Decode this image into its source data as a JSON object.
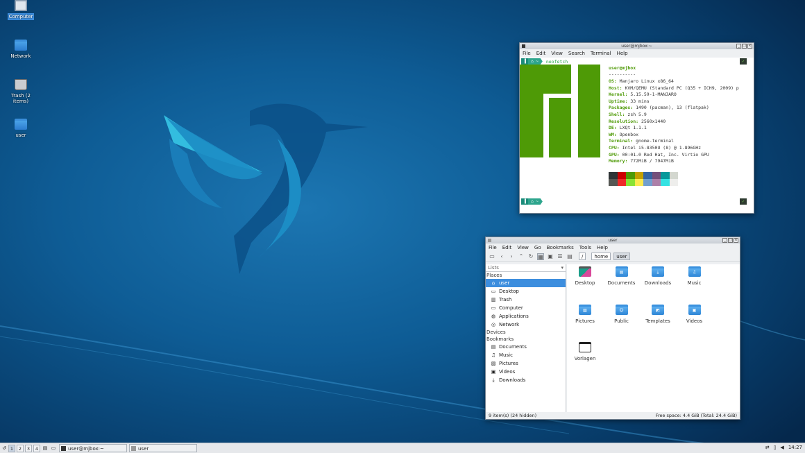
{
  "desktop": {
    "icons": [
      {
        "label": "Computer",
        "icon": "computer-icon",
        "selected": true
      },
      {
        "label": "Network",
        "icon": "network-icon"
      },
      {
        "label": "Trash (2 items)",
        "icon": "trash-icon"
      },
      {
        "label": "user",
        "icon": "home-folder-icon"
      }
    ]
  },
  "terminal": {
    "title": "user@mjbox:~",
    "menu": [
      "File",
      "Edit",
      "View",
      "Search",
      "Terminal",
      "Help"
    ],
    "prompt_symbol": "~",
    "command": "neofetch",
    "header": "user@mjbox",
    "separator": "----------",
    "info": [
      {
        "key": "OS",
        "value": "Manjaro Linux x86_64"
      },
      {
        "key": "Host",
        "value": "KVM/QEMU (Standard PC (Q35 + ICH9, 2009) p"
      },
      {
        "key": "Kernel",
        "value": "5.15.59-1-MANJARO"
      },
      {
        "key": "Uptime",
        "value": "33 mins"
      },
      {
        "key": "Packages",
        "value": "1490 (pacman), 13 (flatpak)"
      },
      {
        "key": "Shell",
        "value": "zsh 5.9"
      },
      {
        "key": "Resolution",
        "value": "2560x1440"
      },
      {
        "key": "DE",
        "value": "LXQt 1.1.1"
      },
      {
        "key": "WM",
        "value": "Openbox"
      },
      {
        "key": "Terminal",
        "value": "gnome-terminal"
      },
      {
        "key": "CPU",
        "value": "Intel i5-8350U (8) @ 1.896GHz"
      },
      {
        "key": "GPU",
        "value": "00:01.0 Red Hat, Inc. Virtio GPU"
      },
      {
        "key": "Memory",
        "value": "772MiB / 7947MiB"
      }
    ],
    "palette_top": [
      "#2e3436",
      "#cc0000",
      "#4e9a06",
      "#c4a000",
      "#3465a4",
      "#75507b",
      "#06989a",
      "#d3d7cf"
    ],
    "palette_bottom": [
      "#555753",
      "#ef2929",
      "#8ae234",
      "#fce94f",
      "#729fcf",
      "#ad7fa8",
      "#34e2e2",
      "#eeeeec"
    ],
    "logo_color": "#4e9a06",
    "check": "✓"
  },
  "filemanager": {
    "title": "user",
    "menu": [
      "File",
      "Edit",
      "View",
      "Go",
      "Bookmarks",
      "Tools",
      "Help"
    ],
    "path": [
      "/",
      "home",
      "user"
    ],
    "side_header": "Lists",
    "places_label": "Places",
    "places": [
      {
        "label": "user",
        "icon": "home-icon",
        "selected": true
      },
      {
        "label": "Desktop",
        "icon": "desktop-icon"
      },
      {
        "label": "Trash",
        "icon": "trash-icon"
      },
      {
        "label": "Computer",
        "icon": "computer-icon"
      },
      {
        "label": "Applications",
        "icon": "applications-icon"
      },
      {
        "label": "Network",
        "icon": "network-icon"
      }
    ],
    "devices_label": "Devices",
    "bookmarks_label": "Bookmarks",
    "bookmarks": [
      {
        "label": "Documents",
        "icon": "documents-icon"
      },
      {
        "label": "Music",
        "icon": "music-icon"
      },
      {
        "label": "Pictures",
        "icon": "pictures-icon"
      },
      {
        "label": "Videos",
        "icon": "videos-icon"
      },
      {
        "label": "Downloads",
        "icon": "downloads-icon"
      }
    ],
    "files": [
      {
        "label": "Desktop",
        "icon": "desktop-folder-icon"
      },
      {
        "label": "Documents",
        "icon": "documents-folder-icon"
      },
      {
        "label": "Downloads",
        "icon": "downloads-folder-icon"
      },
      {
        "label": "Music",
        "icon": "music-folder-icon"
      },
      {
        "label": "Pictures",
        "icon": "pictures-folder-icon"
      },
      {
        "label": "Public",
        "icon": "public-folder-icon"
      },
      {
        "label": "Templates",
        "icon": "templates-folder-icon"
      },
      {
        "label": "Videos",
        "icon": "videos-folder-icon"
      },
      {
        "label": "Vorlagen",
        "icon": "folder-icon"
      }
    ],
    "status_left": "9 item(s) (24 hidden)",
    "status_right": "Free space: 4.4 GiB (Total: 24.4 GiB)"
  },
  "taskbar": {
    "workspaces": [
      "1",
      "2",
      "3",
      "4"
    ],
    "tasks": [
      "user@mjbox:~",
      "user"
    ],
    "clock": "14:27"
  }
}
